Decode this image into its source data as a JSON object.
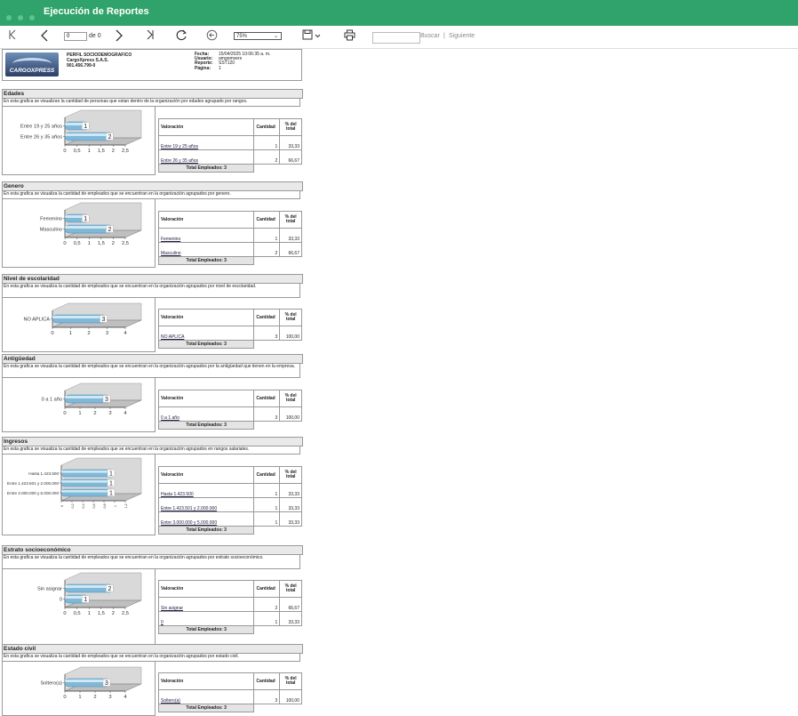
{
  "app": {
    "title": "Ejecución de Reportes"
  },
  "toolbar": {
    "page_value": "0",
    "of_label": "de 0",
    "zoom": "75%",
    "search_label": "Buscar",
    "separator": "|",
    "next_label": "Siguiente"
  },
  "header": {
    "logo_text": "CARGOXPRESS",
    "report_name": "PERFIL SOCIODEMOGRAFICO",
    "company": "CargoXpress S.A.S.",
    "nit": "901.456.799-0",
    "fecha_label": "Fecha:",
    "fecha": "15/04/2025 10:06:35 a. m.",
    "usuario_label": "Usuario:",
    "usuario": "amgomvers",
    "reporte_label": "Reporte:",
    "reporte": "SST120",
    "pagina_label": "Página:",
    "pagina": "1"
  },
  "table_headers": {
    "valoracion": "Valoración",
    "cantidad": "Cantidad",
    "pct": "% del total"
  },
  "sections": [
    {
      "title": "Edades",
      "desc": "En esta grafica se visualizan la cantidad de personas que estan dentro de la organización por edades agrupado por rangos.",
      "rows": [
        {
          "label": "Entre 19 y 25 años",
          "count": "1",
          "pct": "33,33"
        },
        {
          "label": "Entre 26 y 35 años",
          "count": "2",
          "pct": "66,67"
        }
      ],
      "total": "Total Empleados: 3"
    },
    {
      "title": "Genero",
      "desc": "En esta grafica se visualiza la cantidad de empleados que se encuentran en la organización agrupados por genero.",
      "rows": [
        {
          "label": "Femenino",
          "count": "1",
          "pct": "33,33"
        },
        {
          "label": "Masculino",
          "count": "2",
          "pct": "66,67"
        }
      ],
      "total": "Total Empleados: 3"
    },
    {
      "title": "Nivel de escolaridad",
      "desc": "En esta grafica se visualiza la cantidad de empleados que se encuentran en la organización agrupados por nivel de escolaridad.",
      "rows": [
        {
          "label": "NO APLICA",
          "count": "3",
          "pct": "100,00"
        }
      ],
      "total": "Total Empleados: 3"
    },
    {
      "title": "Antigüedad",
      "desc": "En esta grafica se visualiza la cantidad de empleados que se encuentran en la organización agrupados por la antigüedad que tienen en la empresa.",
      "rows": [
        {
          "label": "0 a 1 año",
          "count": "3",
          "pct": "100,00"
        }
      ],
      "total": "Total Empleados: 3"
    },
    {
      "title": "Ingresos",
      "desc": "En esta grafica se visualiza la cantidad de empleados que se encuentran en la organización agrupados en rangos salariales.",
      "rows": [
        {
          "label": "Hasta 1.423.500",
          "count": "1",
          "pct": "33,33"
        },
        {
          "label": "Entre 1.423.501 y 2.000.000",
          "count": "1",
          "pct": "33,33"
        },
        {
          "label": "Entre 3.000.000 y 5.000.000",
          "count": "1",
          "pct": "33,33"
        }
      ],
      "total": "Total Empleados: 3"
    },
    {
      "title": "Estrato socioeconómico",
      "desc": "En esta grafica se visualiza la cantidad de empleados que se encuentran en la organización agrupados por estrato socioeconómico.",
      "rows": [
        {
          "label": "Sin asignar",
          "count": "2",
          "pct": "66,67"
        },
        {
          "label": "0",
          "count": "1",
          "pct": "33,33"
        }
      ],
      "total": "Total Empleados: 3"
    },
    {
      "title": "Estado civil",
      "desc": "En esta grafica se visualiza la cantidad de empleados que se encuentran en la organización agrupados por estado civil.",
      "rows": [
        {
          "label": "Soltero(a)",
          "count": "3",
          "pct": "100,00"
        }
      ],
      "total": "Total Empleados: 3"
    }
  ],
  "chart_data": [
    {
      "type": "bar",
      "categories": [
        "Entre 19 y 25 años",
        "Entre 26 y 35 años"
      ],
      "values": [
        1,
        2
      ],
      "xticks": [
        "0",
        "0,5",
        "1",
        "1,5",
        "2",
        "2,5"
      ],
      "xlim": [
        0,
        2.5
      ]
    },
    {
      "type": "bar",
      "categories": [
        "Femenino",
        "Masculino"
      ],
      "values": [
        1,
        2
      ],
      "xticks": [
        "0",
        "0,5",
        "1",
        "1,5",
        "2",
        "2,5"
      ],
      "xlim": [
        0,
        2.5
      ]
    },
    {
      "type": "bar",
      "categories": [
        "NO APLICA"
      ],
      "values": [
        3
      ],
      "xticks": [
        "0",
        "1",
        "2",
        "3",
        "4"
      ],
      "xlim": [
        0,
        4
      ]
    },
    {
      "type": "bar",
      "categories": [
        "0 a 1 año"
      ],
      "values": [
        3
      ],
      "xticks": [
        "0",
        "1",
        "2",
        "3",
        "4"
      ],
      "xlim": [
        0,
        4
      ]
    },
    {
      "type": "bar",
      "categories": [
        "Hasta 1.423.500",
        "Entre 1.423.501 y 2.000.000",
        "Entre 3.000.000 y 5.000.000"
      ],
      "values": [
        1,
        1,
        1
      ],
      "xticks": [
        "0",
        "0,2",
        "0,4",
        "0,6",
        "0,8",
        "1",
        "1,2"
      ],
      "xlim": [
        0,
        1.2
      ]
    },
    {
      "type": "bar",
      "categories": [
        "Sin asignar",
        "0"
      ],
      "values": [
        2,
        1
      ],
      "xticks": [
        "0",
        "0,5",
        "1",
        "1,5",
        "2",
        "2,5"
      ],
      "xlim": [
        0,
        2.5
      ]
    },
    {
      "type": "bar",
      "categories": [
        "Soltero(a)"
      ],
      "values": [
        3
      ],
      "xticks": [
        "0",
        "1",
        "2",
        "3",
        "4"
      ],
      "xlim": [
        0,
        4
      ]
    }
  ]
}
